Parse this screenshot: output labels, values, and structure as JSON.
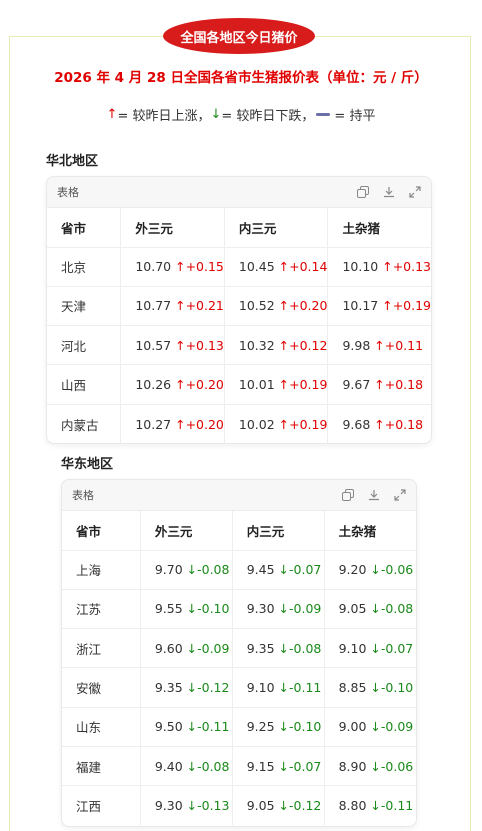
{
  "badge": "全国各地区今日猪价",
  "headline": "2026 年 4 月 28 日全国各省市生猪报价表（单位：元 / 斤）",
  "legend": {
    "up_arrow": "↑",
    "up_text": "= 较昨日上涨，",
    "down_arrow": "↓",
    "down_text": "= 较昨日下跌，",
    "flat_text": "= 持平"
  },
  "colors": {
    "up": "#e00000",
    "down": "#1a8a1a",
    "badge": "#d81c1c"
  },
  "tables": [
    {
      "region": "华北地区",
      "toolbar_label": "表格",
      "headers": [
        "省市",
        "外三元",
        "内三元",
        "土杂猪"
      ],
      "rows": [
        [
          "北京",
          "10.70",
          "↑+0.15",
          "10.45",
          "↑+0.14",
          "10.10",
          "↑+0.13"
        ],
        [
          "天津",
          "10.77",
          "↑+0.21",
          "10.52",
          "↑+0.20",
          "10.17",
          "↑+0.19"
        ],
        [
          "河北",
          "10.57",
          "↑+0.13",
          "10.32",
          "↑+0.12",
          "9.98",
          "↑+0.11"
        ],
        [
          "山西",
          "10.26",
          "↑+0.20",
          "10.01",
          "↑+0.19",
          "9.67",
          "↑+0.18"
        ],
        [
          "内蒙古",
          "10.27",
          "↑+0.20",
          "10.02",
          "↑+0.19",
          "9.68",
          "↑+0.18"
        ]
      ]
    },
    {
      "region": "华东地区",
      "toolbar_label": "表格",
      "headers": [
        "省市",
        "外三元",
        "内三元",
        "土杂猪"
      ],
      "rows": [
        [
          "上海",
          "9.70",
          "↓-0.08",
          "9.45",
          "↓-0.07",
          "9.20",
          "↓-0.06"
        ],
        [
          "江苏",
          "9.55",
          "↓-0.10",
          "9.30",
          "↓-0.09",
          "9.05",
          "↓-0.08"
        ],
        [
          "浙江",
          "9.60",
          "↓-0.09",
          "9.35",
          "↓-0.08",
          "9.10",
          "↓-0.07"
        ],
        [
          "安徽",
          "9.35",
          "↓-0.12",
          "9.10",
          "↓-0.11",
          "8.85",
          "↓-0.10"
        ],
        [
          "山东",
          "9.50",
          "↓-0.11",
          "9.25",
          "↓-0.10",
          "9.00",
          "↓-0.09"
        ],
        [
          "福建",
          "9.40",
          "↓-0.08",
          "9.15",
          "↓-0.07",
          "8.90",
          "↓-0.06"
        ],
        [
          "江西",
          "9.30",
          "↓-0.13",
          "9.05",
          "↓-0.12",
          "8.80",
          "↓-0.11"
        ]
      ]
    }
  ],
  "icons": [
    "copy-icon",
    "download-icon",
    "expand-icon"
  ]
}
